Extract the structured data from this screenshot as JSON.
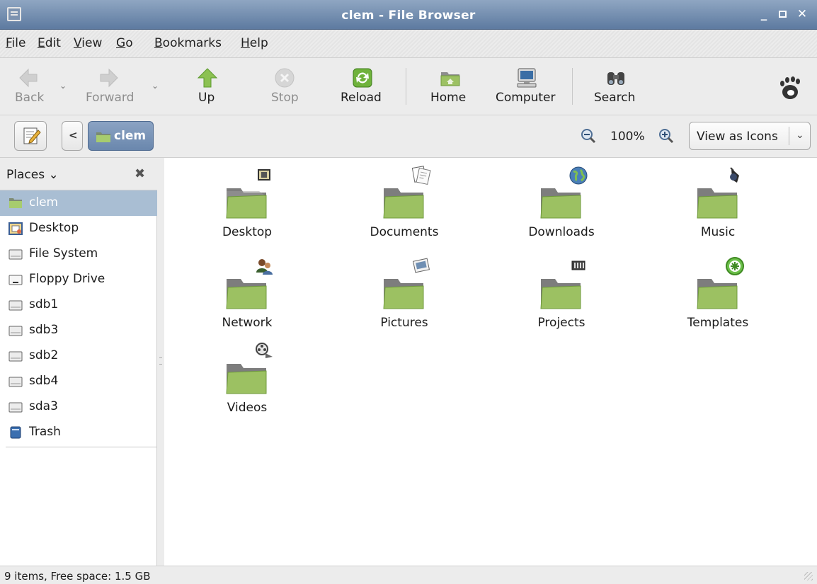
{
  "window": {
    "title": "clem - File Browser"
  },
  "menu": [
    "File",
    "Edit",
    "View",
    "Go",
    "Bookmarks",
    "Help"
  ],
  "toolbar": {
    "back": "Back",
    "forward": "Forward",
    "up": "Up",
    "stop": "Stop",
    "reload": "Reload",
    "home": "Home",
    "computer": "Computer",
    "search": "Search"
  },
  "location": {
    "crumb": "clem",
    "zoom": "100%",
    "view_mode": "View as Icons"
  },
  "sidebar": {
    "header": "Places",
    "places": [
      {
        "label": "clem",
        "icon": "home-folder-icon",
        "selected": true
      },
      {
        "label": "Desktop",
        "icon": "desktop-icon"
      },
      {
        "label": "File System",
        "icon": "drive-icon"
      },
      {
        "label": "Floppy Drive",
        "icon": "floppy-icon"
      },
      {
        "label": "sdb1",
        "icon": "drive-icon"
      },
      {
        "label": "sdb3",
        "icon": "drive-icon"
      },
      {
        "label": "sdb2",
        "icon": "drive-icon"
      },
      {
        "label": "sdb4",
        "icon": "drive-icon"
      },
      {
        "label": "sda3",
        "icon": "drive-icon"
      },
      {
        "label": "Trash",
        "icon": "trash-icon"
      }
    ]
  },
  "files": [
    {
      "label": "Desktop",
      "emblem": "desktop-emblem-icon"
    },
    {
      "label": "Documents",
      "emblem": "documents-emblem-icon"
    },
    {
      "label": "Downloads",
      "emblem": "globe-emblem-icon"
    },
    {
      "label": "Music",
      "emblem": "music-emblem-icon"
    },
    {
      "label": "Network",
      "emblem": "network-emblem-icon"
    },
    {
      "label": "Pictures",
      "emblem": "pictures-emblem-icon"
    },
    {
      "label": "Projects",
      "emblem": "projects-emblem-icon"
    },
    {
      "label": "Templates",
      "emblem": "templates-emblem-icon"
    },
    {
      "label": "Videos",
      "emblem": "videos-emblem-icon"
    }
  ],
  "status": {
    "text": "9 items, Free space: 1.5 GB"
  },
  "colors": {
    "folder_green": "#9cc162",
    "selection": "#a9bed3",
    "titlebar": "#6d88ad"
  }
}
